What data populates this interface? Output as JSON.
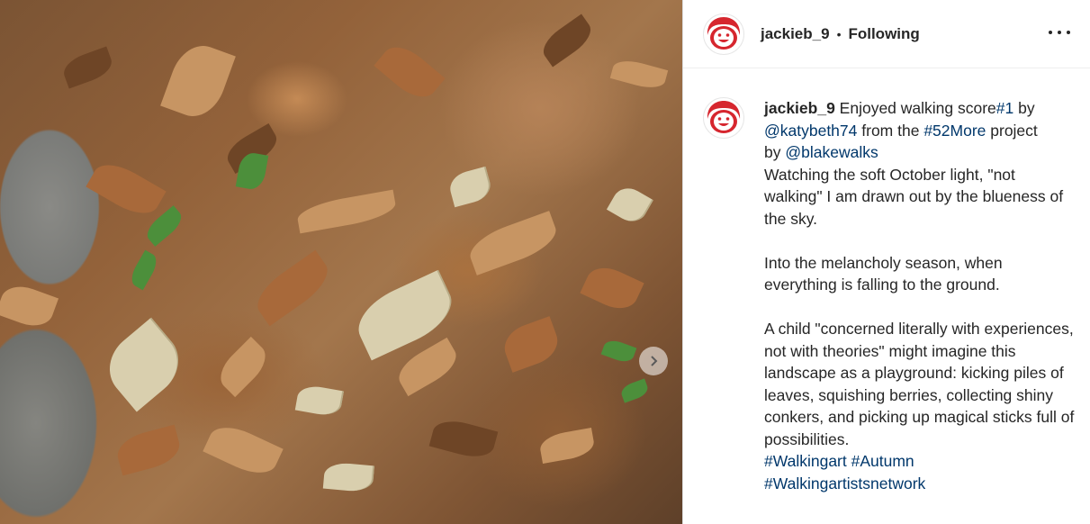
{
  "post": {
    "username": "jackieb_9",
    "separator": "•",
    "follow_status": "Following",
    "more_icon": "more-horizontal-icon"
  },
  "caption": {
    "username": "jackieb_9",
    "line1_a": " Enjoyed walking score",
    "tag1": "#1",
    "line1_b": " by",
    "mention1": "@katybeth74",
    "line2_a": " from the ",
    "tag2": "#52More",
    "line2_b": " project",
    "line3_a": "by ",
    "mention2": "@blakewalks",
    "para1": "Watching the soft October light, \"not walking\" I am drawn out by the blueness of the sky.",
    "para2": "Into the melancholy season, when everything is falling to the ground.",
    "para3": "A child \"concerned literally with experiences, not with theories\" might imagine this landscape as a playground: kicking piles of leaves, squishing berries, collecting shiny conkers, and picking up magical sticks full of possibilities.",
    "hashtag1": "#Walkingart",
    "hashtag2": "#Autumn",
    "hashtag3": "#Walkingartistsnetwork"
  },
  "colors": {
    "link": "#00376b",
    "text": "#262626",
    "avatar_red": "#d6262e"
  }
}
